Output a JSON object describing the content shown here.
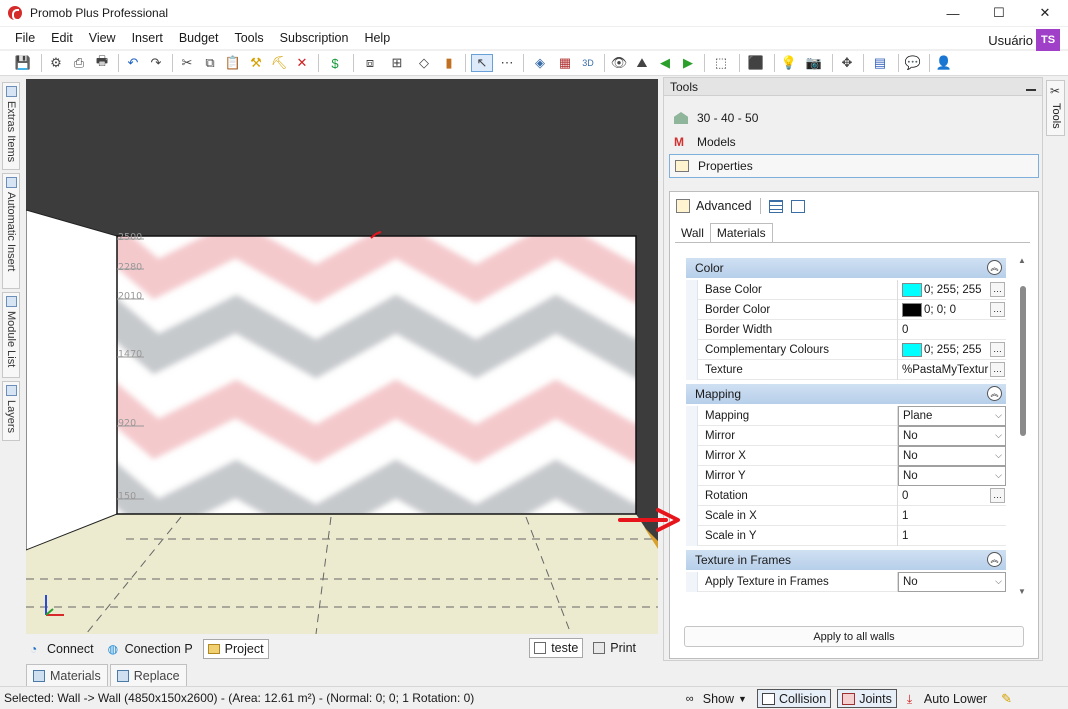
{
  "window": {
    "title": "Promob Plus Professional",
    "minimize": "—",
    "maximize": "☐",
    "close": "✕"
  },
  "menu": [
    "File",
    "Edit",
    "View",
    "Insert",
    "Budget",
    "Tools",
    "Subscription",
    "Help"
  ],
  "user": {
    "name": "Usuário",
    "initials": "TS",
    "badge_color": "#a040c8"
  },
  "left_tabs": [
    "Extras Items",
    "Automatic Insert",
    "Module List",
    "Layers"
  ],
  "viewport": {
    "ruler_labels": [
      "2500",
      "2280",
      "2010",
      "1470",
      "920",
      "150"
    ],
    "wall_colors": {
      "pink": "#f4c9cc",
      "gray": "#c6c9cc",
      "white": "#ffffff"
    },
    "floor_color": "#ecebcf"
  },
  "viewport_tabs": {
    "left": [
      {
        "label": "Connect",
        "icon": "wifi-icon",
        "active": false
      },
      {
        "label": "Conection P",
        "icon": "globe-icon",
        "active": false
      },
      {
        "label": "Project",
        "icon": "folder-icon",
        "active": true
      }
    ],
    "right": [
      {
        "label": "teste",
        "icon": "document-icon",
        "active": true
      },
      {
        "label": "Print",
        "icon": "print-icon",
        "active": false
      }
    ]
  },
  "material_tabs": [
    "Materials",
    "Replace"
  ],
  "tools_panel": {
    "title": "Tools",
    "items": [
      {
        "label": "30 - 40 - 50",
        "icon": "building-icon"
      },
      {
        "label": "Models",
        "icon": "models-m-icon"
      },
      {
        "label": "Properties",
        "icon": "properties-icon",
        "selected": true
      }
    ],
    "advanced_label": "Advanced",
    "subtabs": [
      "Wall",
      "Materials"
    ],
    "active_subtab": "Materials",
    "categories": [
      {
        "name": "Color",
        "rows": [
          {
            "name": "Base Color",
            "value": "0; 255; 255",
            "swatch": "#00ffff",
            "ellipsis": true
          },
          {
            "name": "Border Color",
            "value": "0; 0; 0",
            "swatch": "#000000",
            "ellipsis": true
          },
          {
            "name": "Border Width",
            "value": "0"
          },
          {
            "name": "Complementary Colours",
            "value": "0; 255; 255",
            "swatch": "#00ffff",
            "ellipsis": true
          },
          {
            "name": "Texture",
            "value": "%PastaMyTextur",
            "ellipsis": true
          }
        ]
      },
      {
        "name": "Mapping",
        "rows": [
          {
            "name": "Mapping",
            "value": "Plane",
            "dropdown": true
          },
          {
            "name": "Mirror",
            "value": "No",
            "dropdown": true
          },
          {
            "name": "Mirror X",
            "value": "No",
            "dropdown": true
          },
          {
            "name": "Mirror Y",
            "value": "No",
            "dropdown": true
          },
          {
            "name": "Rotation",
            "value": "0",
            "ellipsis": true
          },
          {
            "name": "Scale in X",
            "value": "1"
          },
          {
            "name": "Scale in Y",
            "value": "1"
          }
        ]
      },
      {
        "name": "Texture in Frames",
        "rows": [
          {
            "name": "Apply Texture in Frames",
            "value": "No",
            "dropdown": true
          }
        ]
      }
    ],
    "apply_button": "Apply to all walls"
  },
  "right_tab": "Tools",
  "status": {
    "text": "Selected: Wall -> Wall (4850x150x2600) - (Area: 12.61 m²) - (Normal: 0; 0; 1 Rotation: 0)",
    "show": "Show",
    "collision": "Collision",
    "joints": "Joints",
    "auto_lower": "Auto Lower"
  },
  "annotation_color": "#e8141c"
}
